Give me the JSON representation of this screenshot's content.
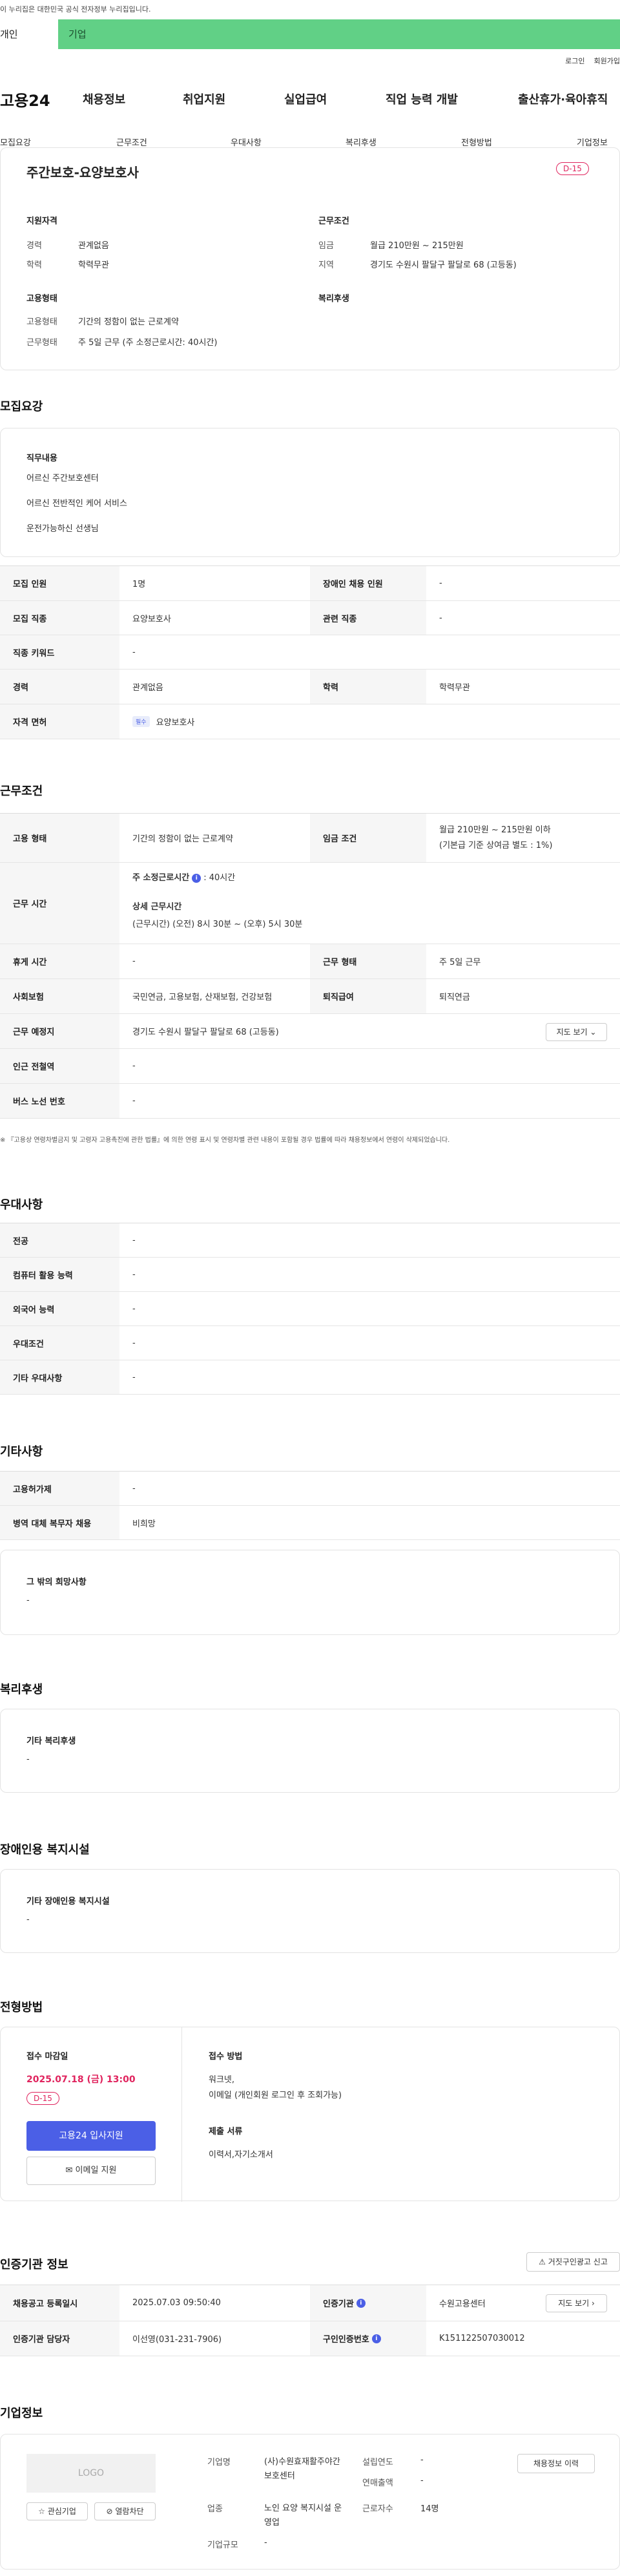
{
  "gov_banner": "이 누리집은 대한민국 공식 전자정부 누리집입니다.",
  "tabs": {
    "individual": "개인",
    "corporate": "기업"
  },
  "util_links": [
    "로그인",
    "회원가입"
  ],
  "logo": "고용24",
  "gnb": [
    "채용정보",
    "취업지원",
    "실업급여",
    "직업 능력 개발",
    "출산휴가·육아휴직"
  ],
  "subnav": [
    "모집요강",
    "근무조건",
    "우대사항",
    "복리후생",
    "전형방법",
    "기업정보"
  ],
  "summary": {
    "title": "주간보호-요양보호사",
    "dday": "D-15",
    "qual_heading": "지원자격",
    "qual": [
      {
        "label": "경력",
        "value": "관계없음"
      },
      {
        "label": "학력",
        "value": "학력무관"
      }
    ],
    "cond_heading": "근무조건",
    "cond": [
      {
        "label": "임금",
        "value": "월급 210만원 ~ 215만원"
      },
      {
        "label": "지역",
        "value": "경기도 수원시 팔달구 팔달로 68 (고등동)"
      }
    ],
    "emp_heading": "고용형태",
    "emp": [
      {
        "label": "고용형태",
        "value": "기간의 정함이 없는 근로계약"
      },
      {
        "label": "근무형태",
        "value": "주 5일 근무 (주 소정근로시간: 40시간)"
      }
    ],
    "welfare_heading": "복리후생"
  },
  "recruit": {
    "heading": "모집요강",
    "duty_heading": "직무내용",
    "duties": [
      "어르신 주간보호센터",
      "어르신 전반적인 케어 서비스",
      "운전가능하신 선생님"
    ],
    "rows": [
      {
        "th": "모집 인원",
        "td": "1명",
        "th2": "장애인 채용 인원",
        "td2": "-"
      },
      {
        "th": "모집 직종",
        "td": "요양보호사",
        "th2": "관련 직종",
        "td2": "-"
      },
      {
        "th": "직종 키워드",
        "td": "-"
      },
      {
        "th": "경력",
        "td": "관계없음",
        "th2": "학력",
        "td2": "학력무관"
      },
      {
        "th": "자격 면허",
        "badge": "필수",
        "td": "요양보호사"
      }
    ]
  },
  "work": {
    "heading": "근무조건",
    "emp_type_th": "고용 형태",
    "emp_type": "기간의 정함이 없는 근로계약",
    "wage_th": "임금 조건",
    "wage_1": "월급 210만원 ~ 215만원 이하",
    "wage_2": "(기본급 기준 상여금 별도 : 1%)",
    "hours_th": "근무 시간",
    "hours_main": "주 소정근로시간",
    "hours_main_val": ": 40시간",
    "hours_detail_label": "상세 근무시간",
    "hours_detail": "(근무시간) (오전) 8시 30분 ~ (오후) 5시 30분",
    "rest_th": "휴게 시간",
    "rest": "-",
    "shift_th": "근무 형태",
    "shift": "주 5일 근무",
    "ins_th": "사회보험",
    "ins": "국민연금, 고용보험, 산재보험, 건강보험",
    "retire_th": "퇴직급여",
    "retire": "퇴직연금",
    "loc_th": "근무 예정지",
    "loc": "경기도 수원시 팔달구 팔달로 68 (고등동)",
    "map_btn": "지도 보기",
    "subway_th": "인근 전철역",
    "subway": "-",
    "bus_th": "버스 노선 번호",
    "bus": "-",
    "notice": "※ 『고용상 연령차별금지 및 고령자 고용촉진에 관한 법률』에 의한 연령 표시 및 연령차별 관련 내용이 포함될 경우 법률에 따라 채용정보에서 연령이 삭제되었습니다."
  },
  "pref": {
    "heading": "우대사항",
    "rows": [
      {
        "th": "전공",
        "td": "-"
      },
      {
        "th": "컴퓨터 활용 능력",
        "td": "-"
      },
      {
        "th": "외국어 능력",
        "td": "-"
      },
      {
        "th": "우대조건",
        "td": "-"
      },
      {
        "th": "기타 우대사항",
        "td": "-"
      }
    ]
  },
  "etc": {
    "heading": "기타사항",
    "rows": [
      {
        "th": "고용허가제",
        "td": "-"
      },
      {
        "th": "병역 대체 복무자 채용",
        "td": "비희망"
      }
    ],
    "other_heading": "그 밖의 희망사항",
    "other": "-"
  },
  "welfare": {
    "heading": "복리후생",
    "sub": "기타 복리후생",
    "val": "-"
  },
  "disabled": {
    "heading": "장애인용 복지시설",
    "sub": "기타 장애인용 복지시설",
    "val": "-"
  },
  "process": {
    "heading": "전형방법",
    "deadline_label": "접수 마감일",
    "deadline": "2025.07.18 (금) 13:00",
    "dday": "D-15",
    "apply_btn": "고용24 입사지원",
    "email_btn": "이메일 지원",
    "method_label": "접수 방법",
    "method_1": "워크넷,",
    "method_2": "이메일 (개인회원 로그인 후 조회가능)",
    "docs_label": "제출 서류",
    "docs": "이력서,자기소개서"
  },
  "agency": {
    "heading": "인증기관 정보",
    "report_btn": "거짓구인광고 신고",
    "reg_th": "채용공고 등록일시",
    "reg": "2025.07.03 09:50:40",
    "org_th": "인증기관",
    "org": "수원고용센터",
    "map_btn": "지도 보기",
    "mgr_th": "인증기관 담당자",
    "mgr": "이선영(031-231-7906)",
    "num_th": "구인인증번호",
    "num": "K151122507030012"
  },
  "company": {
    "heading": "기업정보",
    "logo": "LOGO",
    "fav_btn": "관심기업",
    "block_btn": "열람차단",
    "name_label": "기업명",
    "name": "(사)수원효재활주야간보호센터",
    "year_label": "설립연도",
    "year": "-",
    "sales_label": "연매출액",
    "sales": "-",
    "industry_label": "업종",
    "industry": "노인 요양 복지시설 운영업",
    "emp_label": "근로자수",
    "emp": "14명",
    "size_label": "기업규모",
    "size": "-",
    "jobs_btn": "채용정보 이력"
  }
}
